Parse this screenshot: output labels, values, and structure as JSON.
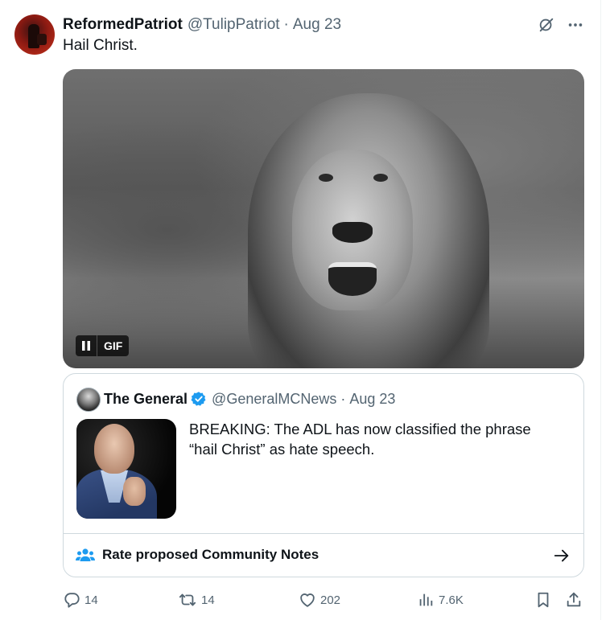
{
  "tweet": {
    "author_name": "ReformedPatriot",
    "author_handle": "@TulipPatriot",
    "separator": "·",
    "date": "Aug 23",
    "text": "Hail Christ.",
    "media": {
      "badge_label": "GIF"
    }
  },
  "quote": {
    "author_name": "The General",
    "author_handle": "@GeneralMCNews",
    "separator": "·",
    "date": "Aug 23",
    "text": "BREAKING: The ADL has now classified the phrase “hail Christ” as hate speech.",
    "community_notes_label": "Rate proposed Community Notes"
  },
  "actions": {
    "replies": "14",
    "reposts": "14",
    "likes": "202",
    "views": "7.6K"
  },
  "colors": {
    "text_primary": "#0f1419",
    "text_secondary": "#536471",
    "border": "#cfd9de",
    "verified_blue": "#1d9bf0"
  }
}
